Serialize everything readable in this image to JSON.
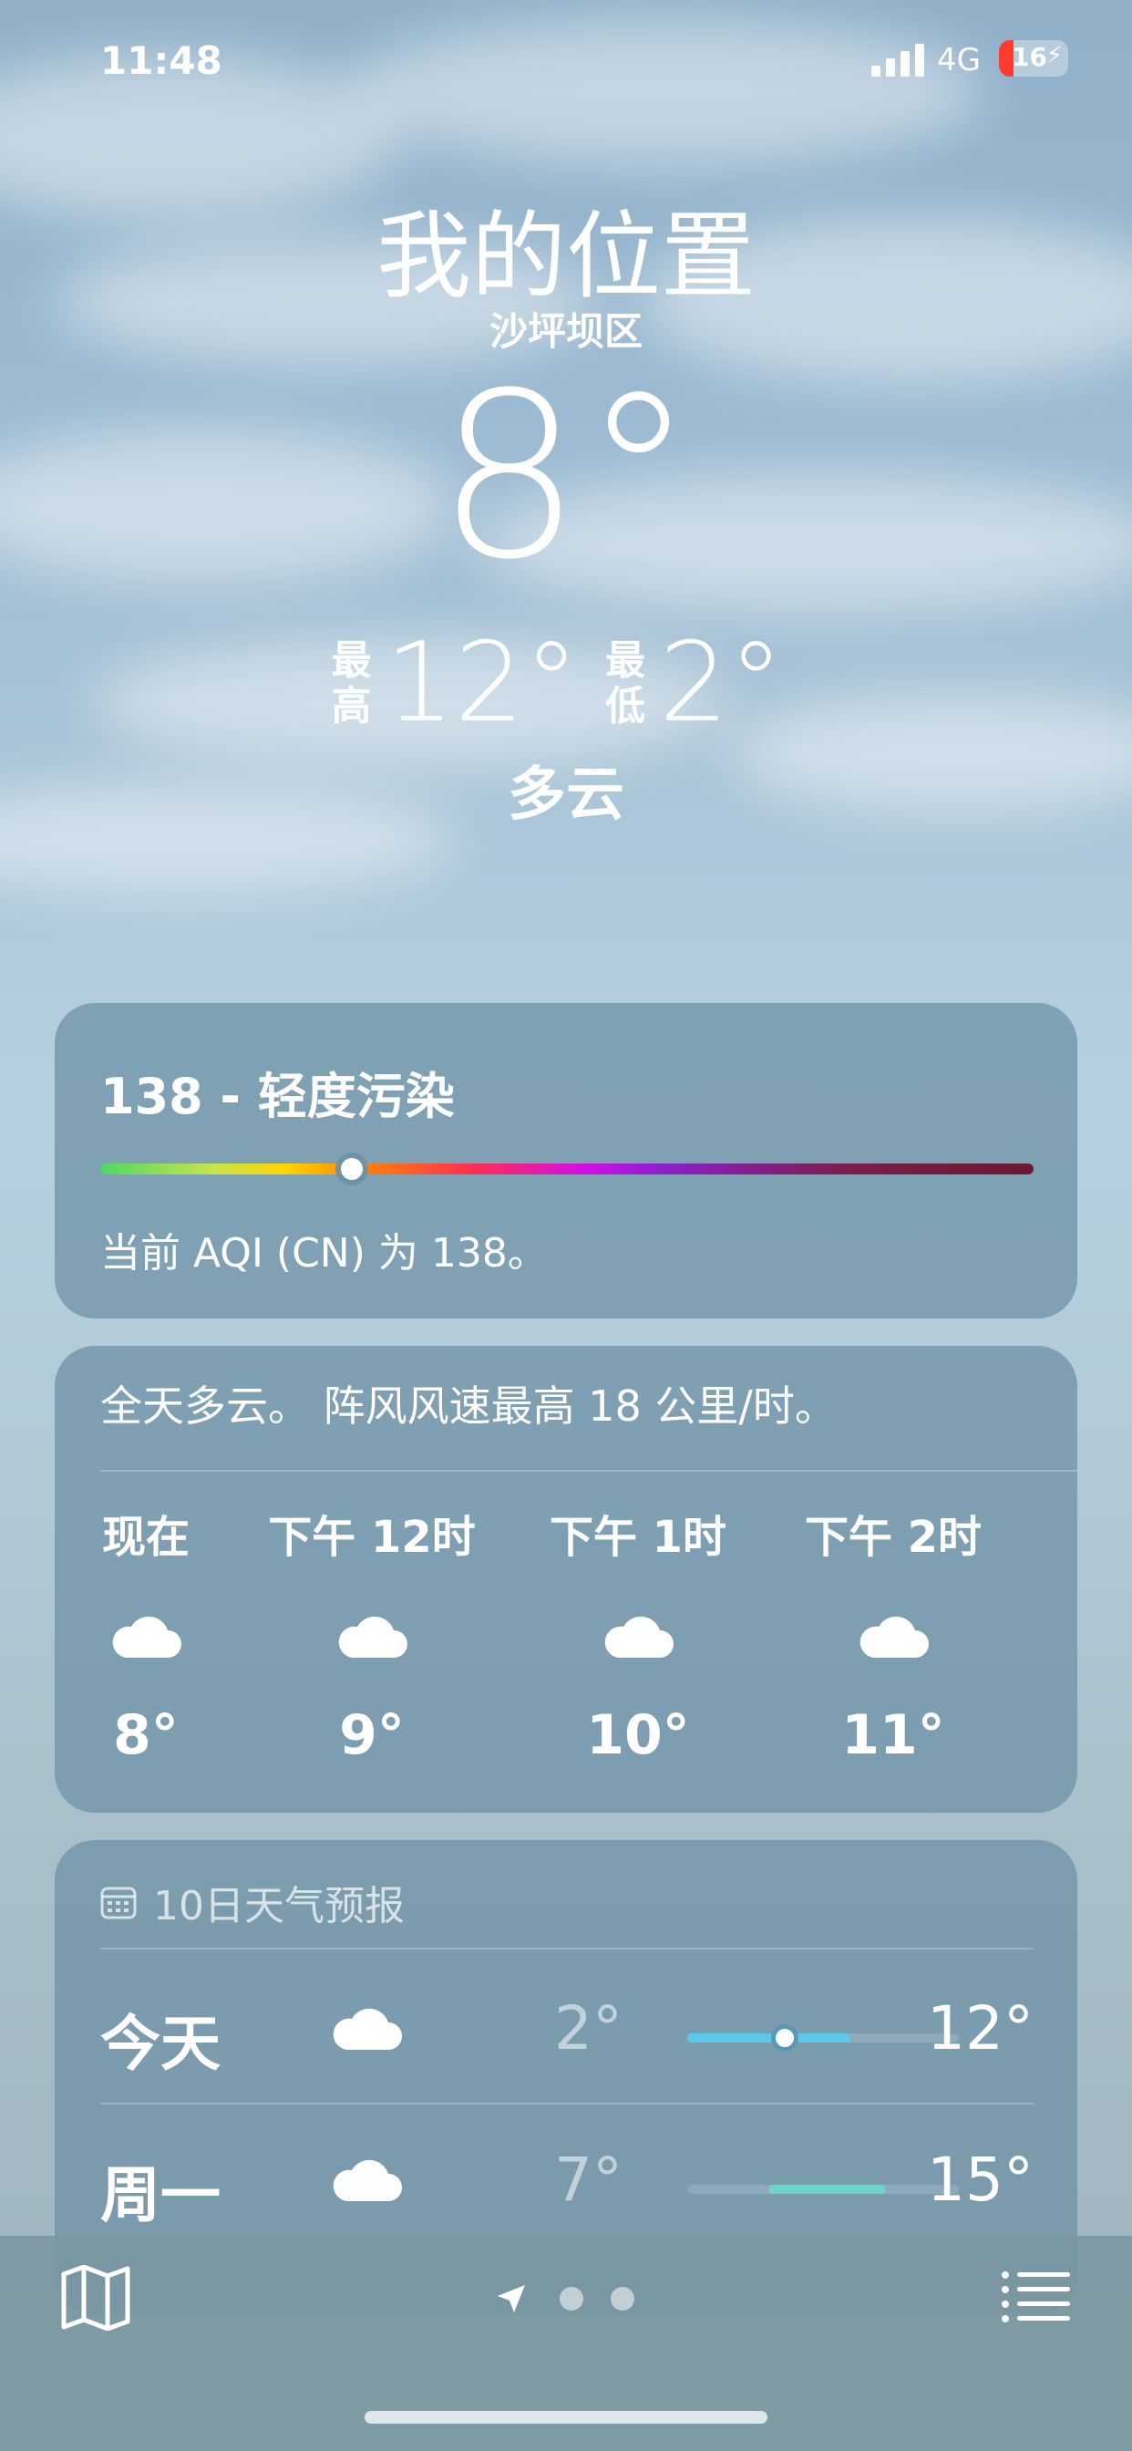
{
  "status_bar": {
    "time": "11:48",
    "network": "4G",
    "battery_percent": "16"
  },
  "location": {
    "title": "我的位置",
    "district": "沙坪坝区"
  },
  "current": {
    "temperature": "8°",
    "high_label": "最高",
    "high": "12°",
    "low_label": "最低",
    "low": "2°",
    "condition": "多云"
  },
  "aqi": {
    "title": "138 - 轻度污染",
    "description": "当前 AQI (CN) 为 138。",
    "level_fraction": 0.27
  },
  "hourly": {
    "summary": "全天多云。 阵风风速最高 18 公里/时。",
    "items": [
      {
        "time": "现在",
        "icon": "cloud-icon",
        "temp": "8°"
      },
      {
        "time": "下午 12时",
        "icon": "cloud-icon",
        "temp": "9°"
      },
      {
        "time": "下午 1时",
        "icon": "cloud-icon",
        "temp": "10°"
      },
      {
        "time": "下午 2时",
        "icon": "cloud-icon",
        "temp": "11°"
      }
    ]
  },
  "ten_day": {
    "header": "10日天气预报",
    "header_icon": "calendar-icon",
    "days": [
      {
        "day": "今天",
        "icon": "cloud-icon",
        "low": "2°",
        "high": "12°",
        "bar_start": 0.0,
        "bar_end": 0.6,
        "current_pos": 0.36,
        "color": "#5ac8e8"
      },
      {
        "day": "周一",
        "icon": "cloud-icon",
        "low": "7°",
        "high": "15°",
        "bar_start": 0.3,
        "bar_end": 0.73,
        "color": "#6fd3c9"
      }
    ]
  },
  "bottom_bar": {
    "map_icon": "map-icon",
    "location_icon": "location-arrow-icon",
    "page_count": 2,
    "list_icon": "list-icon"
  }
}
